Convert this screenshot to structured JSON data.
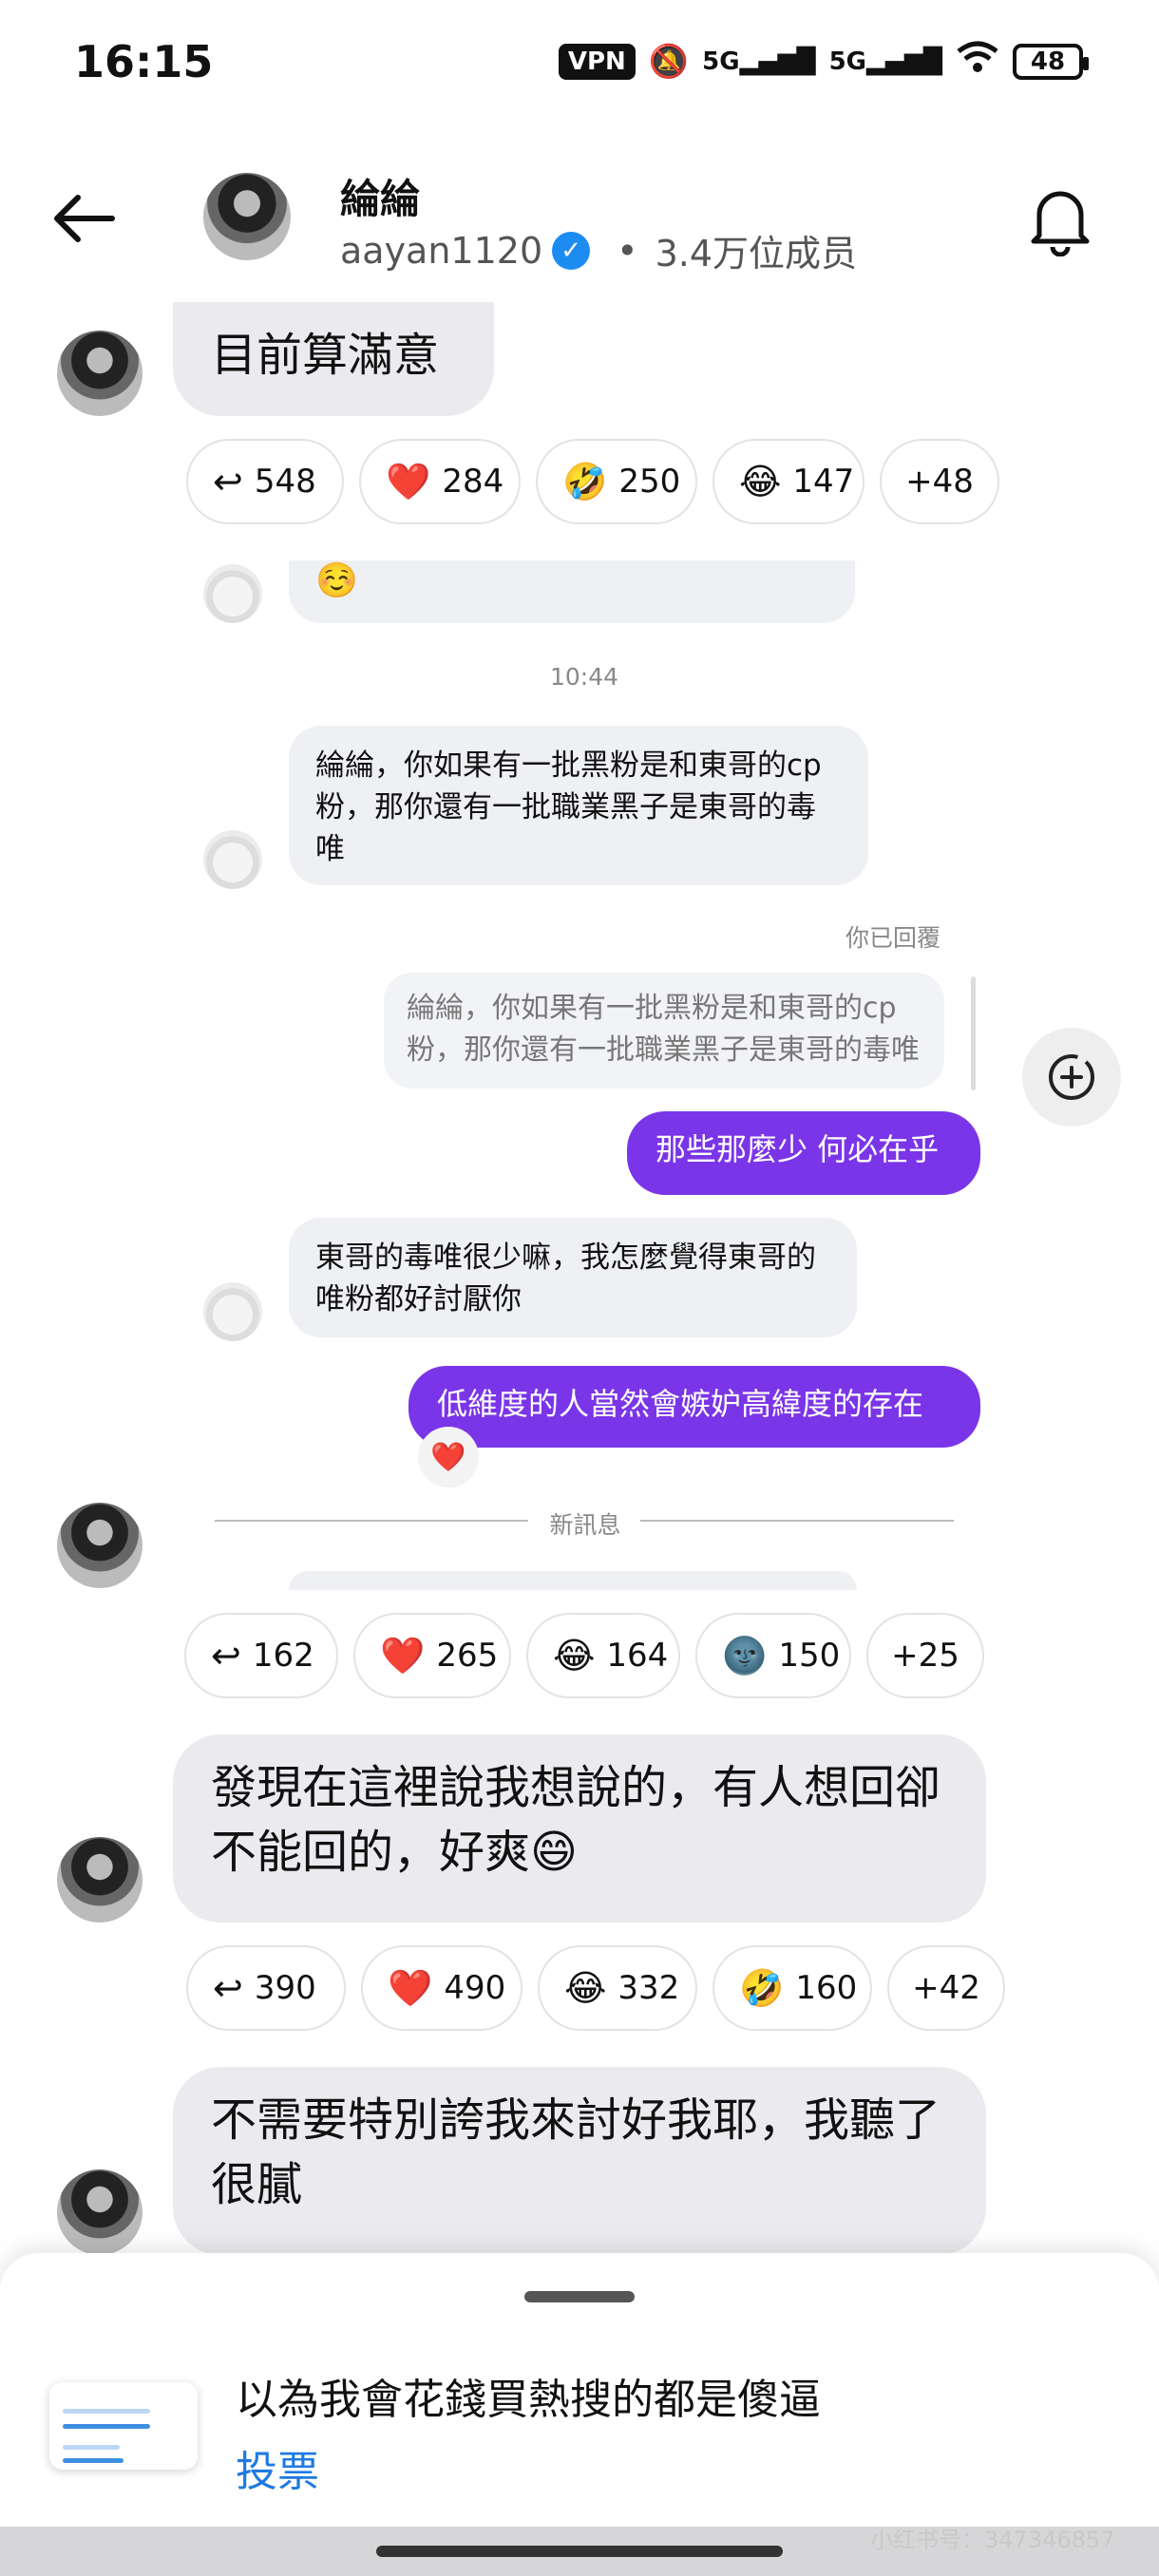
{
  "status_bar": {
    "time": "16:15",
    "vpn": "VPN",
    "network_1": "5G",
    "network_2": "5G",
    "battery": "48"
  },
  "header": {
    "channel_name": "綸綸",
    "handle": "aayan1120",
    "members": "3.4万位成员"
  },
  "messages": {
    "m1_text": "目前算滿意",
    "m1_reactions": [
      {
        "icon": "reply-icon",
        "glyph": "↩",
        "count": "548"
      },
      {
        "icon": "heart-icon",
        "glyph": "❤️",
        "count": "284"
      },
      {
        "icon": "rofl-icon",
        "glyph": "🤣",
        "count": "250"
      },
      {
        "icon": "joy-icon",
        "glyph": "😂",
        "count": "147"
      },
      {
        "icon": "more",
        "glyph": "",
        "count": "+48"
      }
    ],
    "reply_partial_emoji": "☺️",
    "timestamp": "10:44",
    "reply1_text": "綸綸，你如果有一批黑粉是和東哥的cp粉，那你還有一批職業黑子是東哥的毒唯",
    "you_replied": "你已回覆",
    "quote_text": "綸綸，你如果有一批黑粉是和東哥的cp粉，那你還有一批職業黑子是東哥的毒唯",
    "out1_text": "那些那麼少 何必在乎",
    "reply2_text": "東哥的毒唯很少嘛，我怎麼覺得東哥的唯粉都好討厭你",
    "out2_text": "低維度的人當然會嫉妒高緯度的存在",
    "out2_reaction": "❤️",
    "new_messages_label": "新訊息",
    "m2_reactions": [
      {
        "icon": "reply-icon",
        "glyph": "↩",
        "count": "162"
      },
      {
        "icon": "heart-icon",
        "glyph": "❤️",
        "count": "265"
      },
      {
        "icon": "joy-icon",
        "glyph": "😂",
        "count": "164"
      },
      {
        "icon": "moon-face-icon",
        "glyph": "🌚",
        "count": "150"
      },
      {
        "icon": "more",
        "glyph": "",
        "count": "+25"
      }
    ],
    "m3_text": "發現在這裡說我想說的，有人想回卻不能回的，好爽😄",
    "m3_reactions": [
      {
        "icon": "reply-icon",
        "glyph": "↩",
        "count": "390"
      },
      {
        "icon": "heart-icon",
        "glyph": "❤️",
        "count": "490"
      },
      {
        "icon": "joy-icon",
        "glyph": "😂",
        "count": "332"
      },
      {
        "icon": "rofl-icon",
        "glyph": "🤣",
        "count": "160"
      },
      {
        "icon": "more",
        "glyph": "",
        "count": "+42"
      }
    ],
    "m4_text": "不需要特別誇我來討好我耶，我聽了很膩"
  },
  "sheet": {
    "poll_title": "以為我會花錢買熱搜的都是傻逼",
    "vote_label": "投票"
  },
  "watermark": "小红书号：347346857",
  "colors": {
    "outgoing_bubble": "#7b35e8",
    "verified": "#1d8cf0",
    "link": "#1f7ae0"
  }
}
